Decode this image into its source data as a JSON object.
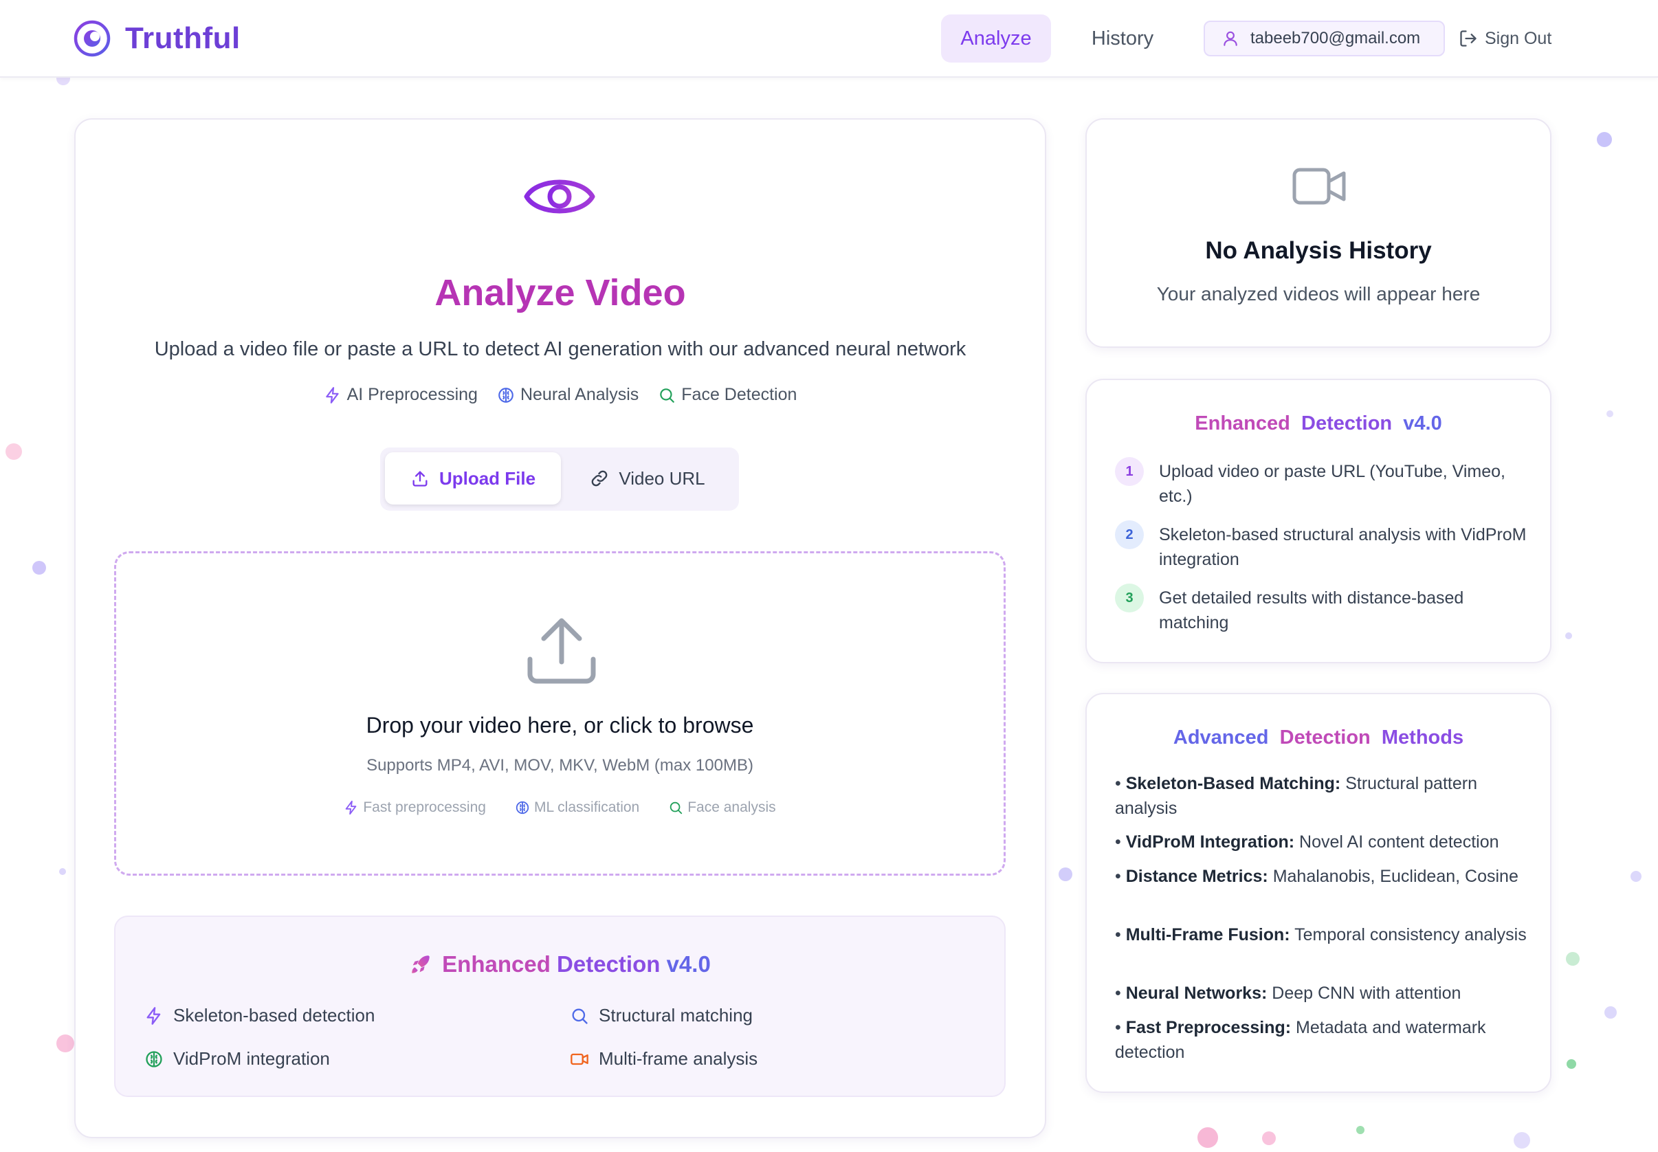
{
  "header": {
    "brand": "Truthful",
    "nav": [
      {
        "label": "Analyze",
        "active": true
      },
      {
        "label": "History",
        "active": false
      }
    ],
    "user_email": "tabeeb700@gmail.com",
    "signout_label": "Sign Out"
  },
  "main": {
    "title": "Analyze Video",
    "subtitle": "Upload a video file or paste a URL to detect AI generation with our advanced neural network",
    "features": [
      {
        "icon": "lightning-icon",
        "label": "AI Preprocessing"
      },
      {
        "icon": "brain-icon",
        "label": "Neural Analysis"
      },
      {
        "icon": "search-icon",
        "label": "Face Detection"
      }
    ],
    "tabs": {
      "upload": "Upload File",
      "url": "Video URL"
    },
    "dropzone": {
      "title": "Drop your video here, or click to browse",
      "subtitle": "Supports MP4, AVI, MOV, MKV, WebM (max 100MB)",
      "features": [
        "Fast preprocessing",
        "ML classification",
        "Face analysis"
      ]
    },
    "enhanced": {
      "title_words": [
        "Enhanced",
        "Detection",
        "v4.0"
      ],
      "items": [
        "Skeleton-based detection",
        "Structural matching",
        "VidProM integration",
        "Multi-frame analysis"
      ]
    }
  },
  "sidebar": {
    "history": {
      "title": "No Analysis History",
      "subtitle": "Your analyzed videos will appear here"
    },
    "steps": {
      "title_words": [
        "Enhanced",
        "Detection",
        "v4.0"
      ],
      "items": [
        {
          "num": "1",
          "text": "Upload video or paste URL (YouTube, Vimeo, etc.)"
        },
        {
          "num": "2",
          "text": "Skeleton-based structural analysis with VidProM integration"
        },
        {
          "num": "3",
          "text": "Get detailed results with distance-based matching"
        }
      ]
    },
    "methods": {
      "title_words": [
        "Advanced",
        "Detection",
        "Methods"
      ],
      "items": [
        {
          "bold": "Skeleton-Based Matching:",
          "text": "Structural pattern analysis"
        },
        {
          "bold": "VidProM Integration:",
          "text": "Novel AI content detection"
        },
        {
          "bold": "Distance Metrics:",
          "text": "Mahalanobis, Euclidean, Cosine"
        },
        {
          "bold": "Multi-Frame Fusion:",
          "text": "Temporal consistency analysis"
        },
        {
          "bold": "Neural Networks:",
          "text": "Deep CNN with attention"
        },
        {
          "bold": "Fast Preprocessing:",
          "text": "Metadata and watermark detection"
        }
      ]
    }
  },
  "colors": {
    "brand_purple": "#7c3aed",
    "title_pink": "#b634b4",
    "indigo": "#6466e8",
    "green": "#22a05a",
    "orange": "#f0641e"
  }
}
